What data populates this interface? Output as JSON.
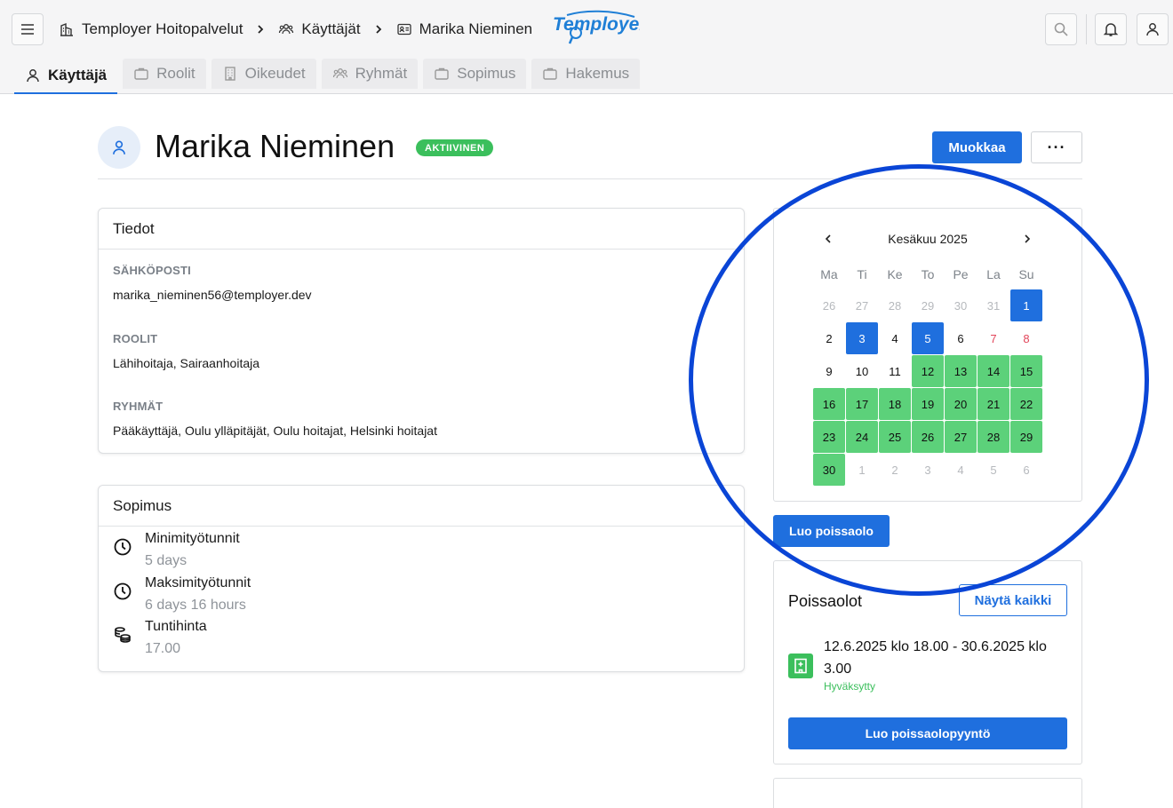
{
  "breadcrumb": {
    "org": "Temployer Hoitopalvelut",
    "users": "Käyttäjät",
    "current": "Marika Nieminen"
  },
  "logo": "Temployer",
  "tabs": [
    {
      "label": "Käyttäjä",
      "icon": "person-icon",
      "active": true
    },
    {
      "label": "Roolit",
      "icon": "briefcase-icon"
    },
    {
      "label": "Oikeudet",
      "icon": "building-icon"
    },
    {
      "label": "Ryhmät",
      "icon": "group-icon"
    },
    {
      "label": "Sopimus",
      "icon": "briefcase-icon"
    },
    {
      "label": "Hakemus",
      "icon": "briefcase-icon"
    }
  ],
  "profile": {
    "name": "Marika Nieminen",
    "status": "AKTIIVINEN",
    "edit_label": "Muokkaa",
    "more_label": "···"
  },
  "info": {
    "title": "Tiedot",
    "email_label": "SÄHKÖPOSTI",
    "email": "marika_nieminen56@temployer.dev",
    "roles_label": "ROOLIT",
    "roles": "Lähihoitaja, Sairaanhoitaja",
    "groups_label": "RYHMÄT",
    "groups": "Pääkäyttäjä, Oulu ylläpitäjät, Oulu hoitajat, Helsinki hoitajat"
  },
  "contract": {
    "title": "Sopimus",
    "rows": [
      {
        "label": "Minimityötunnit",
        "value": "5 days",
        "icon": "clock-icon"
      },
      {
        "label": "Maksimityötunnit",
        "value": "6 days 16 hours",
        "icon": "clock-icon"
      },
      {
        "label": "Tuntihinta",
        "value": "17.00",
        "icon": "coins-icon"
      }
    ]
  },
  "calendar": {
    "month": "Kesäkuu 2025",
    "weekdays": [
      "Ma",
      "Ti",
      "Ke",
      "To",
      "Pe",
      "La",
      "Su"
    ],
    "days": [
      {
        "d": "26",
        "t": "muted"
      },
      {
        "d": "27",
        "t": "muted"
      },
      {
        "d": "28",
        "t": "muted"
      },
      {
        "d": "29",
        "t": "muted"
      },
      {
        "d": "30",
        "t": "muted"
      },
      {
        "d": "31",
        "t": "muted"
      },
      {
        "d": "1",
        "t": "sel"
      },
      {
        "d": "2",
        "t": "norm"
      },
      {
        "d": "3",
        "t": "sel"
      },
      {
        "d": "4",
        "t": "norm"
      },
      {
        "d": "5",
        "t": "sel"
      },
      {
        "d": "6",
        "t": "norm"
      },
      {
        "d": "7",
        "t": "weekend"
      },
      {
        "d": "8",
        "t": "weekend"
      },
      {
        "d": "9",
        "t": "norm"
      },
      {
        "d": "10",
        "t": "norm"
      },
      {
        "d": "11",
        "t": "norm"
      },
      {
        "d": "12",
        "t": "absent"
      },
      {
        "d": "13",
        "t": "absent"
      },
      {
        "d": "14",
        "t": "absent"
      },
      {
        "d": "15",
        "t": "absent"
      },
      {
        "d": "16",
        "t": "absent"
      },
      {
        "d": "17",
        "t": "absent"
      },
      {
        "d": "18",
        "t": "absent"
      },
      {
        "d": "19",
        "t": "absent"
      },
      {
        "d": "20",
        "t": "absent"
      },
      {
        "d": "21",
        "t": "absent"
      },
      {
        "d": "22",
        "t": "absent"
      },
      {
        "d": "23",
        "t": "absent"
      },
      {
        "d": "24",
        "t": "absent"
      },
      {
        "d": "25",
        "t": "absent"
      },
      {
        "d": "26",
        "t": "absent"
      },
      {
        "d": "27",
        "t": "absent"
      },
      {
        "d": "28",
        "t": "absent"
      },
      {
        "d": "29",
        "t": "absent"
      },
      {
        "d": "30",
        "t": "absent"
      },
      {
        "d": "1",
        "t": "muted"
      },
      {
        "d": "2",
        "t": "muted"
      },
      {
        "d": "3",
        "t": "muted"
      },
      {
        "d": "4",
        "t": "muted"
      },
      {
        "d": "5",
        "t": "muted"
      },
      {
        "d": "6",
        "t": "muted"
      }
    ],
    "create_absence_label": "Luo poissaolo"
  },
  "absences": {
    "title": "Poissaolot",
    "show_all_label": "Näytä kaikki",
    "item_text": "12.6.2025 klo 18.00 - 30.6.2025 klo 3.00",
    "item_status": "Hyväksytty",
    "request_label": "Luo poissaolopyyntö"
  },
  "colors": {
    "primary": "#1f6fde",
    "absence": "#5cd17a",
    "status_green": "#3bbf5c",
    "highlight_circle": "#0a45d6"
  }
}
